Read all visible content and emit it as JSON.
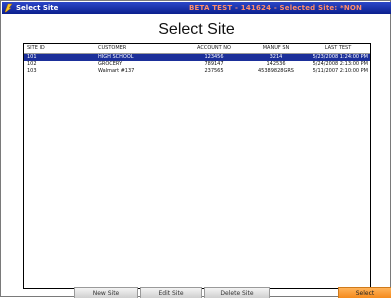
{
  "window": {
    "title": "Select Site",
    "status": "BETA TEST - 141624 - Selected Site: *NON"
  },
  "heading": "Select Site",
  "table": {
    "columns": [
      "SITE ID",
      "CUSTOMER",
      "ACCOUNT NO",
      "MANUF SN",
      "LAST TEST"
    ],
    "rows": [
      {
        "site_id": "101",
        "customer": "HIGH SCHOOL",
        "account_no": "123456",
        "manuf_sn": "3214",
        "last_test": "5/23/2008 1:24:00 PM",
        "selected": true
      },
      {
        "site_id": "102",
        "customer": "GROCERY",
        "account_no": "789147",
        "manuf_sn": "142536",
        "last_test": "5/24/2008 2:13:00 PM",
        "selected": false
      },
      {
        "site_id": "103",
        "customer": "Walmart #137",
        "account_no": "237565",
        "manuf_sn": "45389828GRS",
        "last_test": "5/11/2007 2:10:00 PM",
        "selected": false
      }
    ]
  },
  "buttons": {
    "new_site": "New Site",
    "edit_site": "Edit Site",
    "delete_site": "Delete Site",
    "select": "Select"
  },
  "colors": {
    "titlebar": "#0b1f8e",
    "selection": "#1b2f9a",
    "status_text": "#ff8c6a",
    "select_button": "#f48a1c"
  }
}
